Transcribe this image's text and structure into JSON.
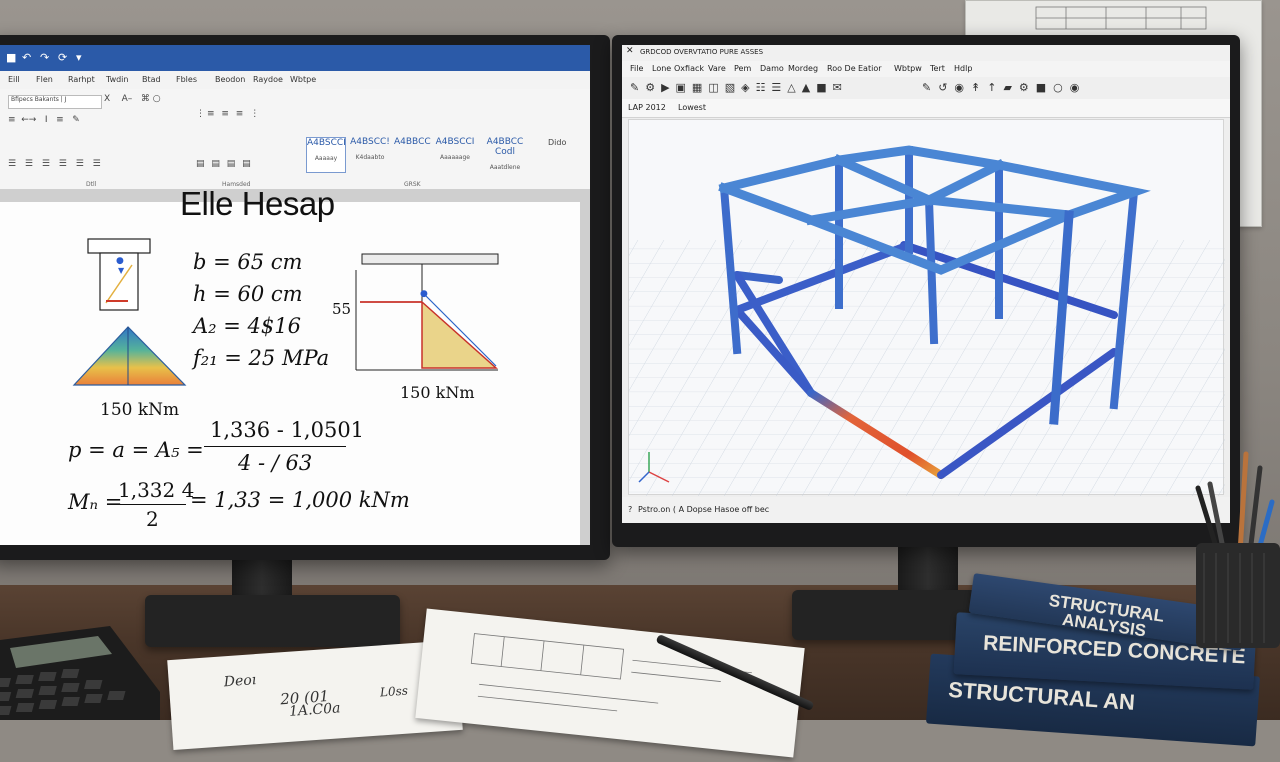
{
  "left_monitor": {
    "app": "word-processor",
    "menu": [
      "Eill",
      "Flen",
      "Rarhpt",
      "Twdin",
      "Btad",
      "Fbles",
      "Beodon",
      "Raydoe",
      "Wbtpe"
    ],
    "ribbon": {
      "font_box": "Bfipecs Bakants | J",
      "styles": [
        "A4BSCCI",
        "A4BSCC!",
        "A4BBCC",
        "A4BSCCI",
        "A4BBCC Codl"
      ],
      "style_captions": [
        "Aaaaay",
        "K4daabto",
        "",
        "Aaaaaage",
        "Aaatdlene"
      ],
      "group_labels": [
        "Dtll",
        "Hamsded",
        "GRSK"
      ],
      "right_label": "Dido"
    },
    "document": {
      "title": "Elle Hesap",
      "params": {
        "b": "b = 65 cm",
        "h": "h = 60 cm",
        "a": "A₂ = 4$16",
        "f": "f₂₁ = 25 MPa"
      },
      "left_diagram_caption": "150 kNm",
      "right_diagram_label": "55",
      "right_diagram_caption": "150 kNm",
      "eq1_lhs": "p = a = A₅ =",
      "eq1_num": "1,336 - 1,0501",
      "eq1_den": "4 - / 63",
      "eq2_lhs": "Mₙ =",
      "eq2_num": "1,332 4",
      "eq2_den": "2",
      "eq2_rhs": "= 1,33 = 1,000 kNm"
    }
  },
  "right_monitor": {
    "app": "structural-analysis",
    "title": "GRDCOD OVERVTATIO PURE ASSES",
    "menu": [
      "File",
      "Lone",
      "Oxfiack",
      "Vare",
      "Pem",
      "Damo",
      "Mordeg",
      "Roo  De",
      "Eatior",
      "Wbtpw",
      "Tert",
      "Hdlp"
    ],
    "toolbar_field": "LAP 2012",
    "toolbar_field2": "Lowest",
    "status": "Pstro.on  (   A Dopse Hasoe off bec",
    "corner_marker": "?"
  },
  "books": {
    "top": "STRUCTURAL ANALYSIS",
    "middle": "REINFORCED CONCRETE",
    "bottom": "STRUCTURAL AN"
  },
  "paper_notes": {
    "line1": "Deoı",
    "line2": "20 (01",
    "line3": "1A.C0a",
    "line4": "L0ss"
  },
  "colors": {
    "word_blue": "#2b5aa8",
    "frame_blue": "#2f63c9",
    "frame_red": "#e0502c",
    "frame_green": "#46b66a",
    "book_navy": "#1f3350"
  }
}
